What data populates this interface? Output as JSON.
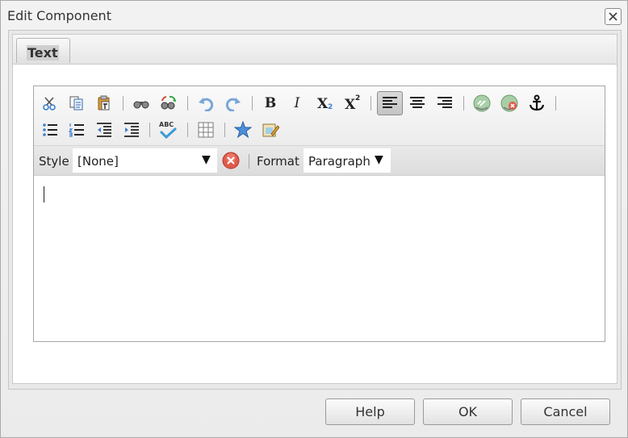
{
  "dialog": {
    "title": "Edit Component"
  },
  "tabs": [
    {
      "label": "Text"
    }
  ],
  "toolbar": {
    "bold_glyph": "B",
    "italic_glyph": "I",
    "subscript_glyph": "X",
    "subscript_mark": "2",
    "superscript_glyph": "X",
    "superscript_mark": "2",
    "spellcheck_glyph": "ABC"
  },
  "style_bar": {
    "style_label": "Style",
    "style_value": "[None]",
    "format_label": "Format",
    "format_value": "Paragraph",
    "arrow": "▼"
  },
  "buttons": {
    "help": "Help",
    "ok": "OK",
    "cancel": "Cancel"
  },
  "colors": {
    "accent_blue": "#3a7fd1",
    "clear_red": "#e05a4a",
    "link_green": "#7fb27f"
  }
}
